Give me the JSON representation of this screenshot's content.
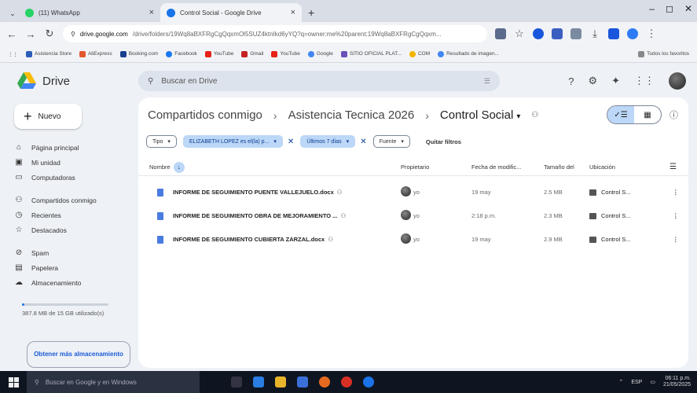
{
  "browser": {
    "tabs": [
      {
        "title": "(11) WhatsApp",
        "color": "#25d366",
        "active": false
      },
      {
        "title": "Control Social - Google Drive",
        "color": "#1a73e8",
        "active": true
      }
    ],
    "new_tab": "+",
    "window_controls": {
      "minimize": "–",
      "maximize": "◻",
      "close": "✕"
    },
    "url_host": "drive.google.com",
    "url_path": "/drive/folders/19Wq8aBXFRgCgQqxmOl5SUZ4ktnIkd6yYQ?q=owner:me%20parent:19Wq8aBXFRgCgQqxm...",
    "bookmarks": [
      {
        "label": "Asistencia Store",
        "color": "#2b5db8"
      },
      {
        "label": "AliExpress",
        "color": "#e4572e"
      },
      {
        "label": "Booking.com",
        "color": "#1a3f8f"
      },
      {
        "label": "Facebook",
        "color": "#1877f2"
      },
      {
        "label": "YouTube",
        "color": "#e62117"
      },
      {
        "label": "Gmail",
        "color": "#c5221f"
      },
      {
        "label": "YouTube",
        "color": "#e62117"
      },
      {
        "label": "Google",
        "color": "#4285f4"
      },
      {
        "label": "SITIO OFICIAL PLAT...",
        "color": "#6b4fbb"
      },
      {
        "label": "COM",
        "color": "#f4b400"
      },
      {
        "label": "Resultado de imagen...",
        "color": "#4285f4"
      }
    ],
    "all_bookmarks": "Todos los favoritos"
  },
  "drive": {
    "app_name": "Drive",
    "search_placeholder": "Buscar en Drive",
    "new_button": "Nuevo",
    "nav": [
      {
        "label": "Página principal",
        "icon": "home-icon",
        "glyph": "⌂"
      },
      {
        "label": "Mi unidad",
        "icon": "my-drive-icon",
        "glyph": "▣"
      },
      {
        "label": "Computadoras",
        "icon": "computer-icon",
        "glyph": "▭"
      },
      {
        "label": "Compartidos conmigo",
        "icon": "shared-icon",
        "glyph": "👥"
      },
      {
        "label": "Recientes",
        "icon": "clock-icon",
        "glyph": "◷"
      },
      {
        "label": "Destacados",
        "icon": "star-icon",
        "glyph": "☆"
      },
      {
        "label": "Spam",
        "icon": "spam-icon",
        "glyph": "⊘"
      },
      {
        "label": "Papelera",
        "icon": "trash-icon",
        "glyph": "🗑"
      },
      {
        "label": "Almacenamiento",
        "icon": "cloud-icon",
        "glyph": "☁"
      }
    ],
    "storage": {
      "text": "387.8 MB de 15 GB utilizado(s)",
      "used_fraction": 0.026
    },
    "get_more_storage": "Obtener más almacenamiento",
    "breadcrumb": [
      "Compartidos conmigo",
      "Asistencia Tecnica 2026",
      "Control Social"
    ],
    "filters": {
      "type": "Tipo",
      "person": "ELIZABETH LOPEZ es el(la) p...",
      "modified": "Últimos 7 días",
      "source": "Fuente",
      "clear": "Quitar filtros"
    },
    "columns": {
      "name": "Nombre",
      "owner": "Propietario",
      "modified": "Fecha de modific...",
      "size": "Tamaño del",
      "location": "Ubicación"
    },
    "files": [
      {
        "name": "INFORME DE SEGUIMIENTO PUENTE VALLEJUELO.docx",
        "owner": "yo",
        "modified": "19 may",
        "size": "2.5 MB",
        "location": "Control S..."
      },
      {
        "name": "INFORME DE SEGUIMIENTO OBRA DE MEJORAMIENTO ...",
        "owner": "yo",
        "modified": "2:18 p.m.",
        "size": "2.3 MB",
        "location": "Control S..."
      },
      {
        "name": "INFORME DE SEGUIMIENTO CUBIERTA ZARZAL.docx",
        "owner": "yo",
        "modified": "19 may",
        "size": "2.9 MB",
        "location": "Control S..."
      }
    ]
  },
  "taskbar": {
    "search_placeholder": "Buscar en Google y en Windows",
    "lang": "ESP",
    "time": "06:11 p.m.",
    "date": "21/05/2025"
  }
}
